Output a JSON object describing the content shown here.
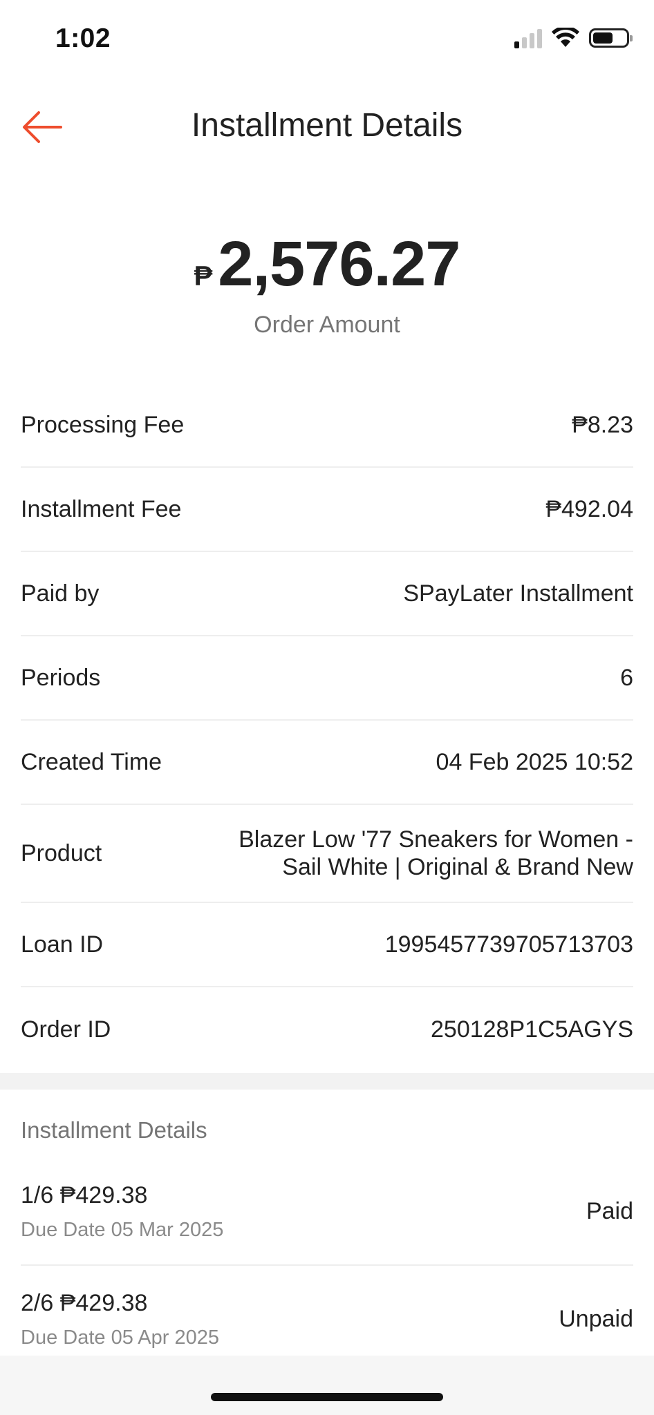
{
  "status_bar": {
    "time": "1:02",
    "icons": [
      "cellular-signal-icon",
      "wifi-icon",
      "battery-icon"
    ],
    "battery_level": 0.6
  },
  "header": {
    "title": "Installment Details",
    "back_icon": "arrow-left-icon",
    "accent_color": "#ee4d2d"
  },
  "amount": {
    "currency": "₱",
    "value": "2,576.27",
    "label": "Order Amount"
  },
  "details": [
    {
      "label": "Processing Fee",
      "value": "₱8.23"
    },
    {
      "label": "Installment Fee",
      "value": "₱492.04"
    },
    {
      "label": "Paid by",
      "value": "SPayLater Installment"
    },
    {
      "label": "Periods",
      "value": "6"
    },
    {
      "label": "Created Time",
      "value": "04 Feb 2025 10:52"
    },
    {
      "label": "Product",
      "value_line1": "Blazer Low '77 Sneakers for Women -",
      "value_line2": "Sail White | Original & Brand New"
    },
    {
      "label": "Loan ID",
      "value": "1995457739705713703"
    },
    {
      "label": "Order ID",
      "value": "250128P1C5AGYS"
    }
  ],
  "installments": {
    "heading": "Installment Details",
    "items": [
      {
        "title": "1/6 ₱429.38",
        "due": "Due Date 05 Mar 2025",
        "status": "Paid"
      },
      {
        "title": "2/6 ₱429.38",
        "due": "Due Date 05 Apr 2025",
        "status": "Unpaid"
      }
    ]
  }
}
